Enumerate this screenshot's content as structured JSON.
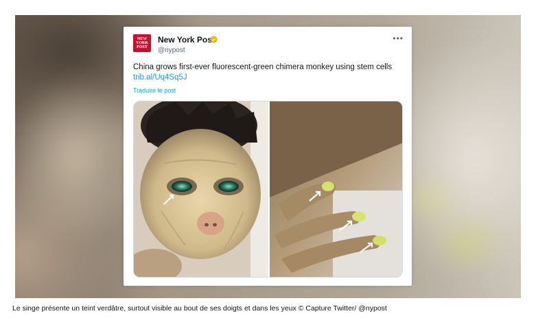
{
  "tweet": {
    "account_name": "New York Post",
    "handle": "@nypost",
    "avatar_text": "NEW YORK POST",
    "more": "•••",
    "text": "China grows first-ever fluorescent-green chimera monkey using stem cells ",
    "link": "trib.al/Uq4Sq5J",
    "translate": "Traduire le post",
    "verified_color": "#f5b800",
    "avatar_color": "#c8102e",
    "link_color": "#1d9bf0"
  },
  "media": {
    "left_image": "monkey-face-photo",
    "right_image": "monkey-fingers-photo"
  },
  "caption": "Le singe présente un teint verdâtre, surtout visible au bout de ses doigts et dans les yeux © Capture Twitter/ @nypost"
}
